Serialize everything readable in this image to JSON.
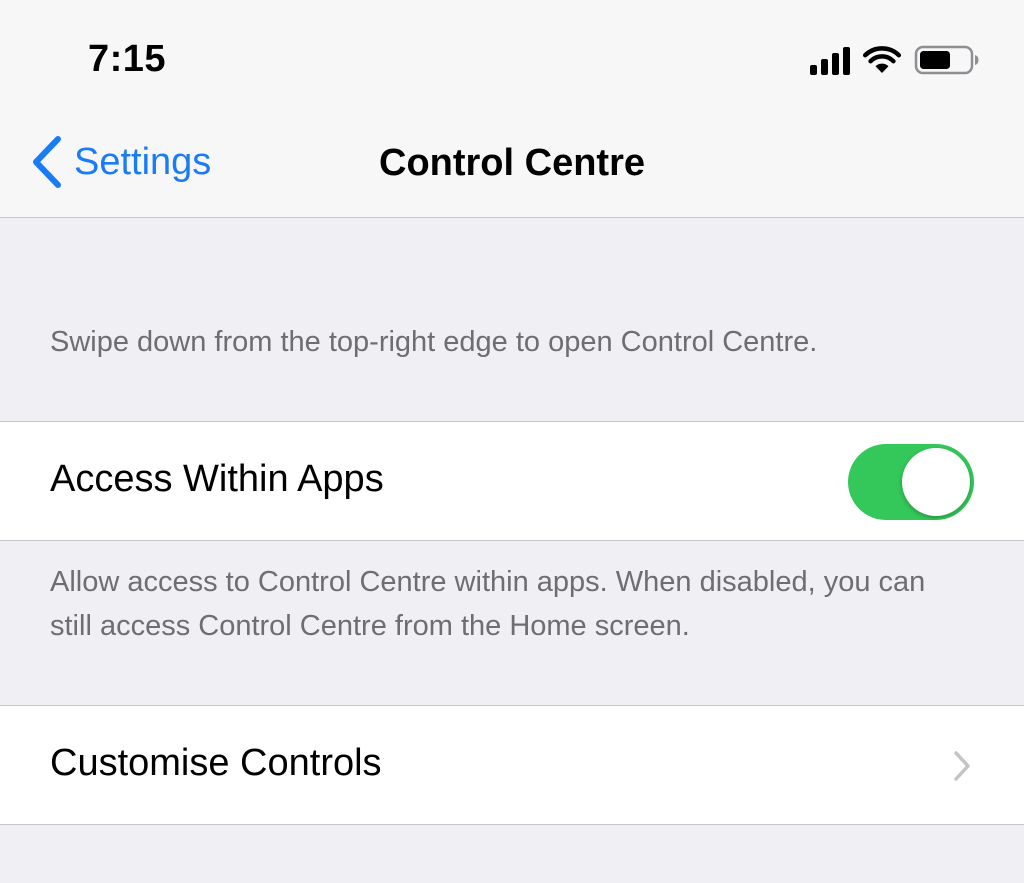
{
  "status_bar": {
    "time": "7:15",
    "signal_icon": "cellular-signal-icon",
    "wifi_icon": "wifi-icon",
    "battery_icon": "battery-icon"
  },
  "nav": {
    "back_label": "Settings",
    "back_icon": "chevron-left-icon",
    "title": "Control Centre"
  },
  "intro_text": "Swipe down from the top-right edge to open Control Centre.",
  "access_within_apps": {
    "label": "Access Within Apps",
    "enabled": true,
    "footer": "Allow access to Control Centre within apps. When disabled, you can still access Control Centre from the Home screen."
  },
  "customise_controls": {
    "label": "Customise Controls",
    "icon": "chevron-right-icon"
  },
  "colors": {
    "accent": "#1a7cf5",
    "toggle_on": "#34c759",
    "background": "#efeff4",
    "secondary_text": "#6d6d72"
  }
}
